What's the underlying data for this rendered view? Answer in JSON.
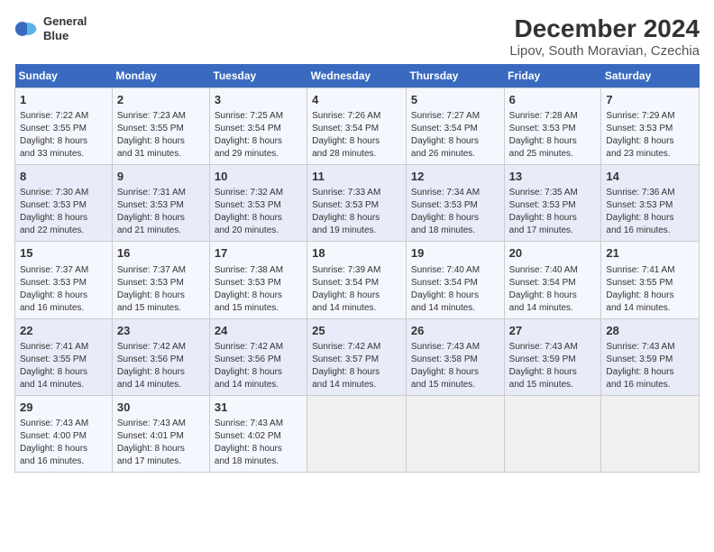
{
  "header": {
    "logo_line1": "General",
    "logo_line2": "Blue",
    "title": "December 2024",
    "subtitle": "Lipov, South Moravian, Czechia"
  },
  "days_of_week": [
    "Sunday",
    "Monday",
    "Tuesday",
    "Wednesday",
    "Thursday",
    "Friday",
    "Saturday"
  ],
  "weeks": [
    [
      {
        "day": "1",
        "info": "Sunrise: 7:22 AM\nSunset: 3:55 PM\nDaylight: 8 hours\nand 33 minutes."
      },
      {
        "day": "2",
        "info": "Sunrise: 7:23 AM\nSunset: 3:55 PM\nDaylight: 8 hours\nand 31 minutes."
      },
      {
        "day": "3",
        "info": "Sunrise: 7:25 AM\nSunset: 3:54 PM\nDaylight: 8 hours\nand 29 minutes."
      },
      {
        "day": "4",
        "info": "Sunrise: 7:26 AM\nSunset: 3:54 PM\nDaylight: 8 hours\nand 28 minutes."
      },
      {
        "day": "5",
        "info": "Sunrise: 7:27 AM\nSunset: 3:54 PM\nDaylight: 8 hours\nand 26 minutes."
      },
      {
        "day": "6",
        "info": "Sunrise: 7:28 AM\nSunset: 3:53 PM\nDaylight: 8 hours\nand 25 minutes."
      },
      {
        "day": "7",
        "info": "Sunrise: 7:29 AM\nSunset: 3:53 PM\nDaylight: 8 hours\nand 23 minutes."
      }
    ],
    [
      {
        "day": "8",
        "info": "Sunrise: 7:30 AM\nSunset: 3:53 PM\nDaylight: 8 hours\nand 22 minutes."
      },
      {
        "day": "9",
        "info": "Sunrise: 7:31 AM\nSunset: 3:53 PM\nDaylight: 8 hours\nand 21 minutes."
      },
      {
        "day": "10",
        "info": "Sunrise: 7:32 AM\nSunset: 3:53 PM\nDaylight: 8 hours\nand 20 minutes."
      },
      {
        "day": "11",
        "info": "Sunrise: 7:33 AM\nSunset: 3:53 PM\nDaylight: 8 hours\nand 19 minutes."
      },
      {
        "day": "12",
        "info": "Sunrise: 7:34 AM\nSunset: 3:53 PM\nDaylight: 8 hours\nand 18 minutes."
      },
      {
        "day": "13",
        "info": "Sunrise: 7:35 AM\nSunset: 3:53 PM\nDaylight: 8 hours\nand 17 minutes."
      },
      {
        "day": "14",
        "info": "Sunrise: 7:36 AM\nSunset: 3:53 PM\nDaylight: 8 hours\nand 16 minutes."
      }
    ],
    [
      {
        "day": "15",
        "info": "Sunrise: 7:37 AM\nSunset: 3:53 PM\nDaylight: 8 hours\nand 16 minutes."
      },
      {
        "day": "16",
        "info": "Sunrise: 7:37 AM\nSunset: 3:53 PM\nDaylight: 8 hours\nand 15 minutes."
      },
      {
        "day": "17",
        "info": "Sunrise: 7:38 AM\nSunset: 3:53 PM\nDaylight: 8 hours\nand 15 minutes."
      },
      {
        "day": "18",
        "info": "Sunrise: 7:39 AM\nSunset: 3:54 PM\nDaylight: 8 hours\nand 14 minutes."
      },
      {
        "day": "19",
        "info": "Sunrise: 7:40 AM\nSunset: 3:54 PM\nDaylight: 8 hours\nand 14 minutes."
      },
      {
        "day": "20",
        "info": "Sunrise: 7:40 AM\nSunset: 3:54 PM\nDaylight: 8 hours\nand 14 minutes."
      },
      {
        "day": "21",
        "info": "Sunrise: 7:41 AM\nSunset: 3:55 PM\nDaylight: 8 hours\nand 14 minutes."
      }
    ],
    [
      {
        "day": "22",
        "info": "Sunrise: 7:41 AM\nSunset: 3:55 PM\nDaylight: 8 hours\nand 14 minutes."
      },
      {
        "day": "23",
        "info": "Sunrise: 7:42 AM\nSunset: 3:56 PM\nDaylight: 8 hours\nand 14 minutes."
      },
      {
        "day": "24",
        "info": "Sunrise: 7:42 AM\nSunset: 3:56 PM\nDaylight: 8 hours\nand 14 minutes."
      },
      {
        "day": "25",
        "info": "Sunrise: 7:42 AM\nSunset: 3:57 PM\nDaylight: 8 hours\nand 14 minutes."
      },
      {
        "day": "26",
        "info": "Sunrise: 7:43 AM\nSunset: 3:58 PM\nDaylight: 8 hours\nand 15 minutes."
      },
      {
        "day": "27",
        "info": "Sunrise: 7:43 AM\nSunset: 3:59 PM\nDaylight: 8 hours\nand 15 minutes."
      },
      {
        "day": "28",
        "info": "Sunrise: 7:43 AM\nSunset: 3:59 PM\nDaylight: 8 hours\nand 16 minutes."
      }
    ],
    [
      {
        "day": "29",
        "info": "Sunrise: 7:43 AM\nSunset: 4:00 PM\nDaylight: 8 hours\nand 16 minutes."
      },
      {
        "day": "30",
        "info": "Sunrise: 7:43 AM\nSunset: 4:01 PM\nDaylight: 8 hours\nand 17 minutes."
      },
      {
        "day": "31",
        "info": "Sunrise: 7:43 AM\nSunset: 4:02 PM\nDaylight: 8 hours\nand 18 minutes."
      },
      {
        "day": "",
        "info": ""
      },
      {
        "day": "",
        "info": ""
      },
      {
        "day": "",
        "info": ""
      },
      {
        "day": "",
        "info": ""
      }
    ]
  ]
}
